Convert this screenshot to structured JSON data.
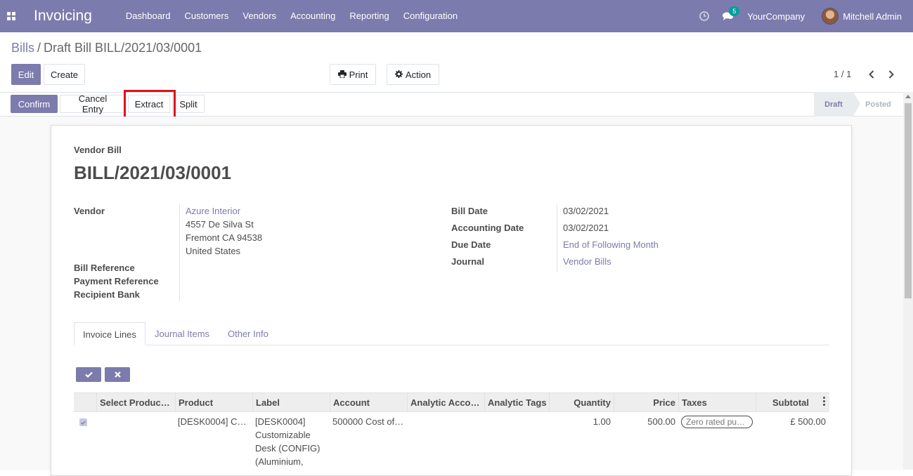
{
  "navbar": {
    "app_name": "Invoicing",
    "menu": [
      "Dashboard",
      "Customers",
      "Vendors",
      "Accounting",
      "Reporting",
      "Configuration"
    ],
    "messages_count": "5",
    "company": "YourCompany",
    "user": "Mitchell Admin",
    "color": "#7c7bad"
  },
  "breadcrumb": {
    "parent": "Bills",
    "separator": "/",
    "current": "Draft Bill BILL/2021/03/0001"
  },
  "control": {
    "edit_label": "Edit",
    "create_label": "Create",
    "print_label": "Print",
    "action_label": "Action",
    "pager": "1 / 1"
  },
  "statusbar": {
    "confirm_label": "Confirm",
    "cancel_label": "Cancel Entry",
    "extract_label": "Extract",
    "split_label": "Split",
    "stages": [
      "Draft",
      "Posted"
    ],
    "current_stage": "Draft",
    "highlight_color": "#e0101a"
  },
  "form": {
    "doc_type": "Vendor Bill",
    "title": "BILL/2021/03/0001",
    "left": {
      "vendor_label": "Vendor",
      "vendor_name": "Azure Interior",
      "vendor_address": [
        "4557 De Silva St",
        "Fremont CA 94538",
        "United States"
      ],
      "bill_reference_label": "Bill Reference",
      "payment_reference_label": "Payment Reference",
      "recipient_bank_label": "Recipient Bank"
    },
    "right": {
      "bill_date_label": "Bill Date",
      "bill_date": "03/02/2021",
      "accounting_date_label": "Accounting Date",
      "accounting_date": "03/02/2021",
      "due_date_label": "Due Date",
      "due_date": "End of Following Month",
      "journal_label": "Journal",
      "journal": "Vendor Bills"
    }
  },
  "tabs": [
    "Invoice Lines",
    "Journal Items",
    "Other Info"
  ],
  "active_tab": "Invoice Lines",
  "table": {
    "headers": [
      "Select Produc…",
      "Product",
      "Label",
      "Account",
      "Analytic Acco…",
      "Analytic Tags",
      "Quantity",
      "Price",
      "Taxes",
      "Subtotal"
    ],
    "rows": [
      {
        "selected": true,
        "product": "[DESK0004] C…",
        "label_lines": [
          "[DESK0004]",
          "Customizable",
          "Desk (CONFIG)",
          "(Aluminium,"
        ],
        "account": "500000 Cost of…",
        "analytic_account": "",
        "analytic_tags": "",
        "quantity": "1.00",
        "price": "500.00",
        "taxes": "Zero rated pur…",
        "subtotal": "£ 500.00"
      }
    ]
  },
  "icons": [
    "apps-grid-icon",
    "clock-icon",
    "chat-icon",
    "print-icon",
    "gear-icon",
    "check-icon",
    "close-icon",
    "chevron-left-icon",
    "chevron-right-icon",
    "kebab-icon"
  ]
}
